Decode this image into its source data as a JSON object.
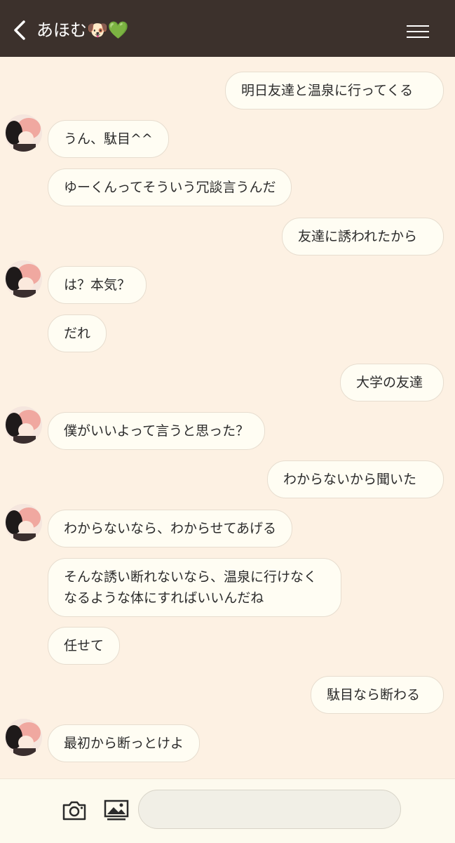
{
  "header": {
    "title": "あほむ🐶💚",
    "back_icon": "chevron-left-icon",
    "menu_icon": "hamburger-menu-icon"
  },
  "messages": [
    {
      "side": "right",
      "text": "明日友達と温泉に行ってくる"
    },
    {
      "side": "left",
      "avatar": true,
      "text": "うん、駄目^^"
    },
    {
      "side": "left",
      "text": "ゆーくんってそういう冗談言うんだ"
    },
    {
      "side": "right",
      "text": "友達に誘われたから"
    },
    {
      "side": "left",
      "avatar": true,
      "text": "は？本気？"
    },
    {
      "side": "left",
      "text": "だれ"
    },
    {
      "side": "right",
      "text": "大学の友達"
    },
    {
      "side": "left",
      "avatar": true,
      "text": "僕がいいよって言うと思った？"
    },
    {
      "side": "right",
      "text": "わからないから聞いた"
    },
    {
      "side": "left",
      "avatar": true,
      "text": "わからないなら、わからせてあげる"
    },
    {
      "side": "left",
      "text": "そんな誘い断れないなら、温泉に行けなくなるような体にすればいいんだね"
    },
    {
      "side": "left",
      "text": "任せて"
    },
    {
      "side": "right",
      "text": "駄目なら断わる"
    },
    {
      "side": "left",
      "avatar": true,
      "text": "最初から断っとけよ"
    }
  ],
  "footer": {
    "camera_icon": "camera-icon",
    "image_icon": "image-icon",
    "input_value": "",
    "input_placeholder": ""
  },
  "colors": {
    "header_bg": "#3c312c",
    "chat_bg": "#fdf1e3",
    "bubble_bg": "#fffdf3",
    "footer_bg": "#fdfaee"
  }
}
